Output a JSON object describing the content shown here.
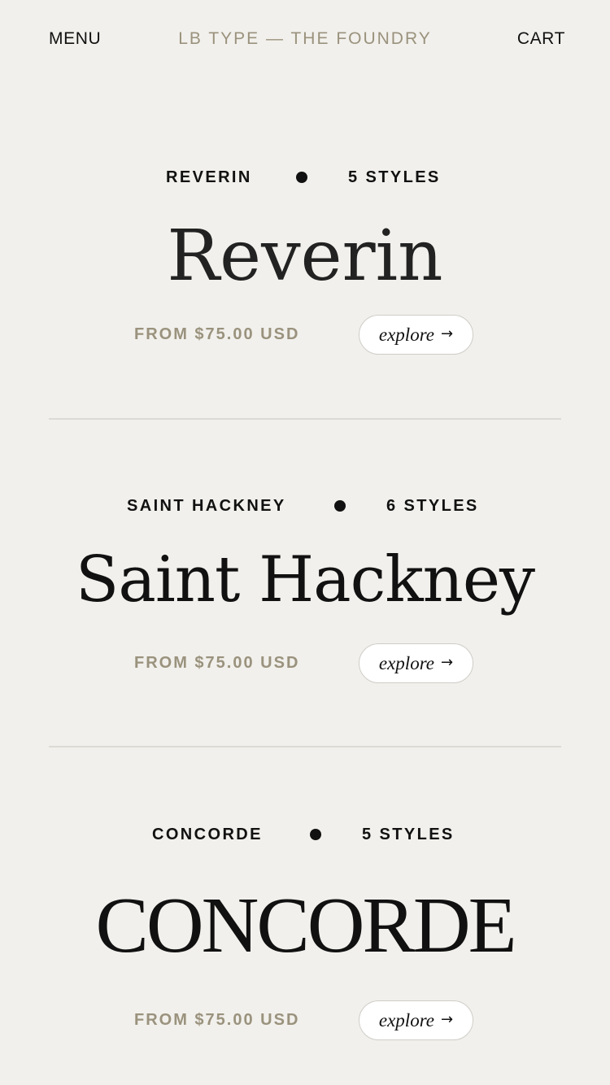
{
  "nav": {
    "menu_label": "MENU",
    "brand_label": "LB TYPE — THE FOUNDRY",
    "cart_label": "CART"
  },
  "fonts": [
    {
      "name": "REVERIN",
      "styles": "5 STYLES",
      "specimen": "Reverin",
      "price": "FROM $75.00 USD",
      "explore_label": "explore"
    },
    {
      "name": "SAINT HACKNEY",
      "styles": "6 STYLES",
      "specimen": "Saint Hackney",
      "price": "FROM $75.00 USD",
      "explore_label": "explore"
    },
    {
      "name": "CONCORDE",
      "styles": "5 STYLES",
      "specimen": "CONCORDE",
      "price": "FROM $75.00 USD",
      "explore_label": "explore"
    }
  ],
  "icons": {
    "explore_arrow": "arrow-right-icon",
    "separator": "dot-icon"
  },
  "colors": {
    "background": "#f1f0ec",
    "accent": "#9a927d",
    "text": "#111111",
    "button_bg": "#ffffff",
    "divider": "#dcdad5"
  }
}
